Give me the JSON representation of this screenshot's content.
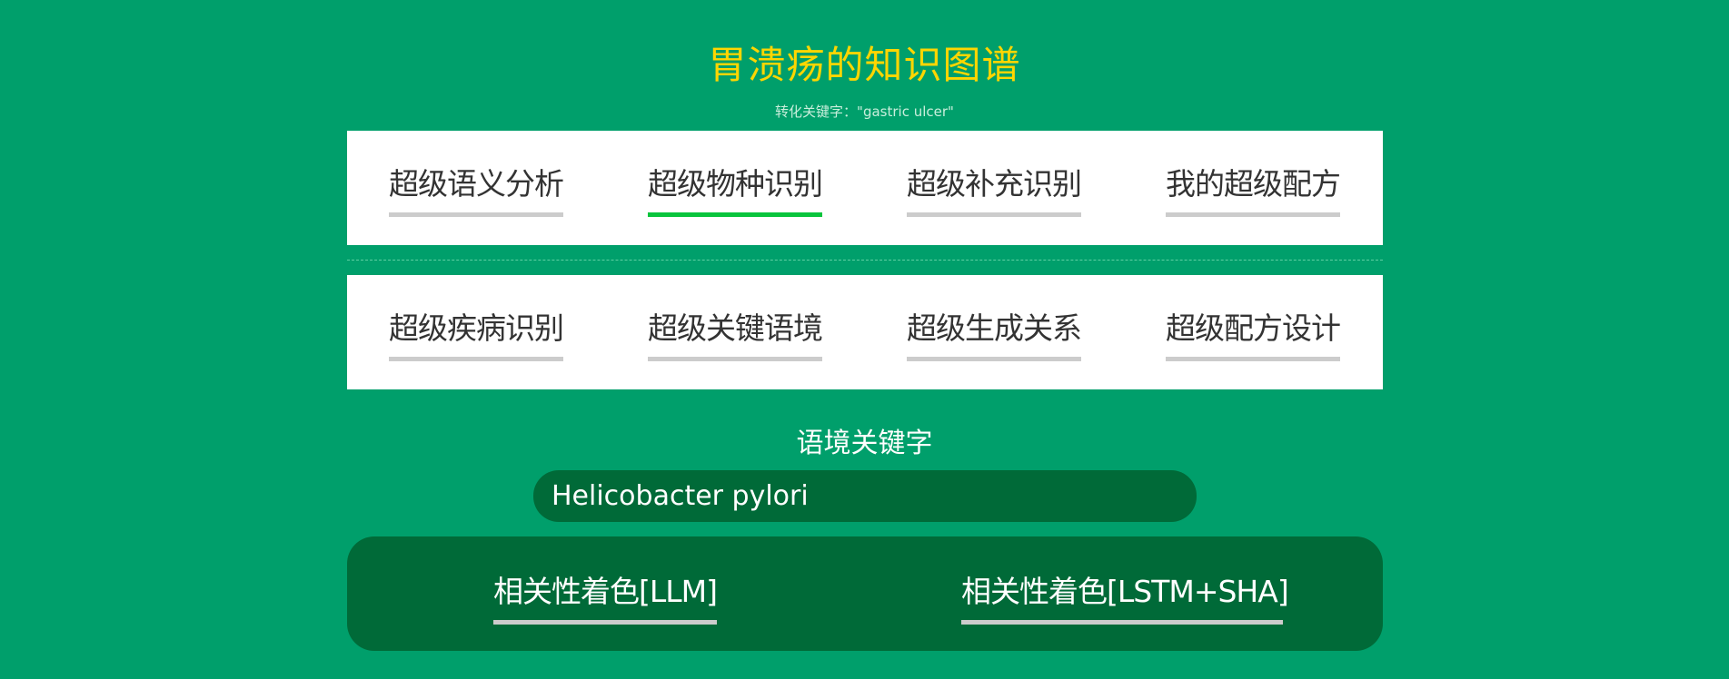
{
  "header": {
    "title": "胃溃疡的知识图谱",
    "subtitle": "转化关键字：\"gastric ulcer\""
  },
  "tabs_row1": [
    {
      "label": "超级语义分析",
      "active": false
    },
    {
      "label": "超级物种识别",
      "active": true
    },
    {
      "label": "超级补充识别",
      "active": false
    },
    {
      "label": "我的超级配方",
      "active": false
    }
  ],
  "tabs_row2": [
    {
      "label": "超级疾病识别",
      "active": false
    },
    {
      "label": "超级关键语境",
      "active": false
    },
    {
      "label": "超级生成关系",
      "active": false
    },
    {
      "label": "超级配方设计",
      "active": false
    }
  ],
  "keyword": {
    "label": "语境关键字",
    "value": "Helicobacter pylori"
  },
  "color_buttons": [
    {
      "label": "相关性着色[LLM]"
    },
    {
      "label": "相关性着色[LSTM+SHA]"
    }
  ],
  "colors": {
    "background": "#009f6b",
    "title": "#ffd600",
    "active_underline": "#09c43c",
    "inactive_underline": "#cccccc",
    "dark_panel": "#006a38"
  }
}
